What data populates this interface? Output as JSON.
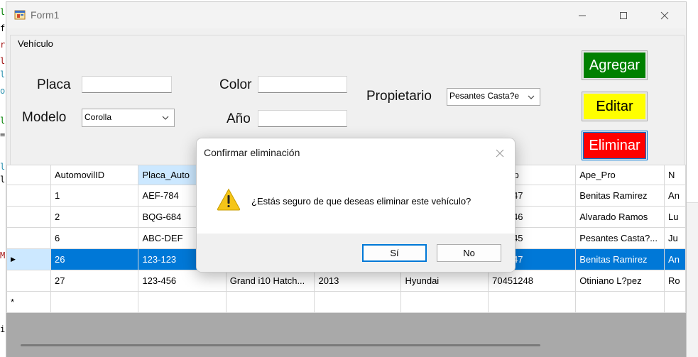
{
  "ide": {
    "snippets": [
      "lo",
      "fi",
      "ro",
      "li",
      "lt",
      "or",
      "lo",
      "=",
      "li",
      "lo",
      "M",
      "i"
    ]
  },
  "window": {
    "title": "Form1"
  },
  "group": {
    "caption": "Vehículo"
  },
  "form": {
    "placa_label": "Placa",
    "placa_value": "",
    "modelo_label": "Modelo",
    "modelo_value": "Corolla",
    "color_label": "Color",
    "color_value": "",
    "anio_label": "Año",
    "anio_value": "",
    "propietario_label": "Propietario",
    "propietario_value": "Pesantes Casta?e"
  },
  "actions": {
    "agregar": "Agregar",
    "editar": "Editar",
    "eliminar": "Eliminar"
  },
  "grid": {
    "columns": [
      "AutomovilID",
      "Placa_Auto",
      "",
      "",
      "",
      "l_Prop",
      "Ape_Pro",
      "N"
    ],
    "rows": [
      [
        "",
        "1",
        "AEF-784",
        "",
        "",
        "",
        "451247",
        "Benitas Ramirez",
        "An"
      ],
      [
        "",
        "2",
        "BQG-684",
        "",
        "",
        "",
        "451246",
        "Alvarado Ramos",
        "Lu"
      ],
      [
        "",
        "6",
        "ABC-DEF",
        "",
        "",
        "",
        "451245",
        "Pesantes Casta?...",
        "Ju"
      ],
      [
        "▶",
        "26",
        "123-123",
        "",
        "",
        "",
        "451247",
        "Benitas Ramirez",
        "An"
      ],
      [
        "",
        "27",
        "123-456",
        "Grand i10 Hatch...",
        "2013",
        "Hyundai",
        "70451248",
        "Otiniano L?pez",
        "Ro"
      ],
      [
        "*",
        "",
        "",
        "",
        "",
        "",
        "",
        "",
        ""
      ]
    ]
  },
  "dialog": {
    "title": "Confirmar eliminación",
    "message": "¿Estás seguro de que deseas eliminar este vehículo?",
    "yes": "Sí",
    "no": "No"
  },
  "colors": {
    "agregar": "#008000",
    "editar": "#ffff00",
    "eliminar": "#ff0000",
    "selection": "#0078d7"
  }
}
